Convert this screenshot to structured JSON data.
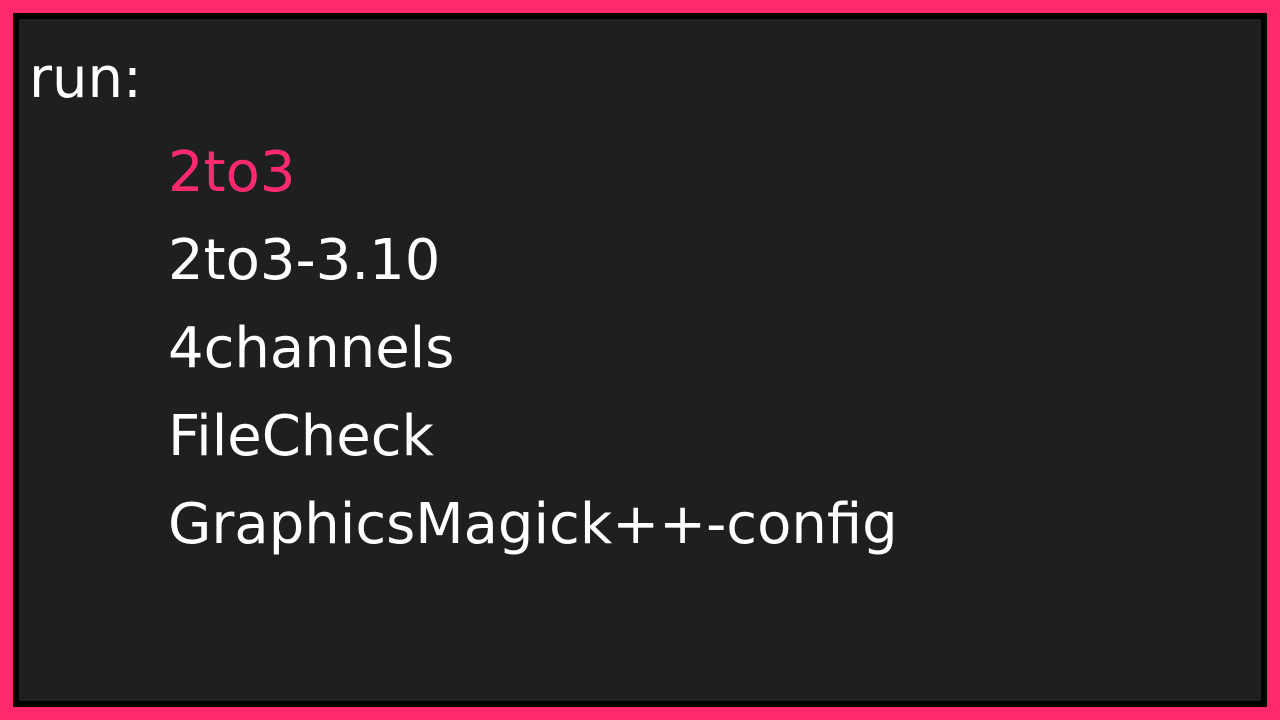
{
  "prompt": {
    "label": "run:"
  },
  "menu": {
    "items": [
      {
        "label": "2to3",
        "selected": true
      },
      {
        "label": "2to3-3.10",
        "selected": false
      },
      {
        "label": "4channels",
        "selected": false
      },
      {
        "label": "FileCheck",
        "selected": false
      },
      {
        "label": "GraphicsMagick++-config",
        "selected": false
      }
    ]
  },
  "colors": {
    "accent": "#ff2a6d",
    "background": "#1d1f21",
    "text": "#ffffff",
    "border_inner": "#000000"
  }
}
